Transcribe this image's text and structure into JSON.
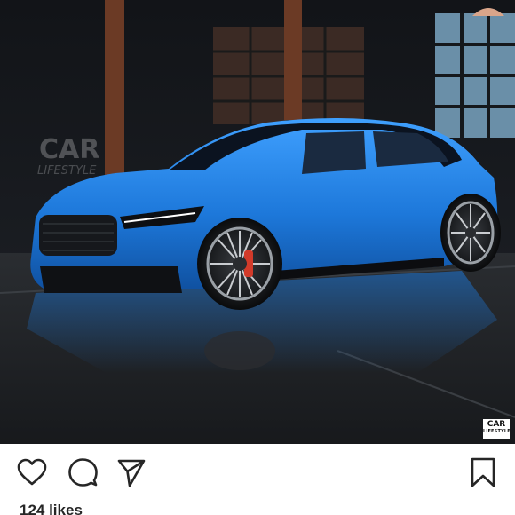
{
  "post": {
    "photo_alt": "Blue SUV in a dark warehouse on a reflective floor",
    "watermark_top_line1": "CAR",
    "watermark_top_line2": "LIFESTYLE",
    "watermark_corner_line1": "CAR",
    "watermark_corner_line2": "LIFESTYLE"
  },
  "actions": {
    "like_icon": "heart-outline",
    "comment_icon": "speech-bubble-outline",
    "share_icon": "paper-plane-outline",
    "save_icon": "bookmark-outline"
  },
  "engagement": {
    "likes_text": "124 likes"
  },
  "colors": {
    "car_body": "#1f7fe0",
    "icon_stroke": "#262626",
    "text_primary": "#262626",
    "background": "#ffffff"
  }
}
